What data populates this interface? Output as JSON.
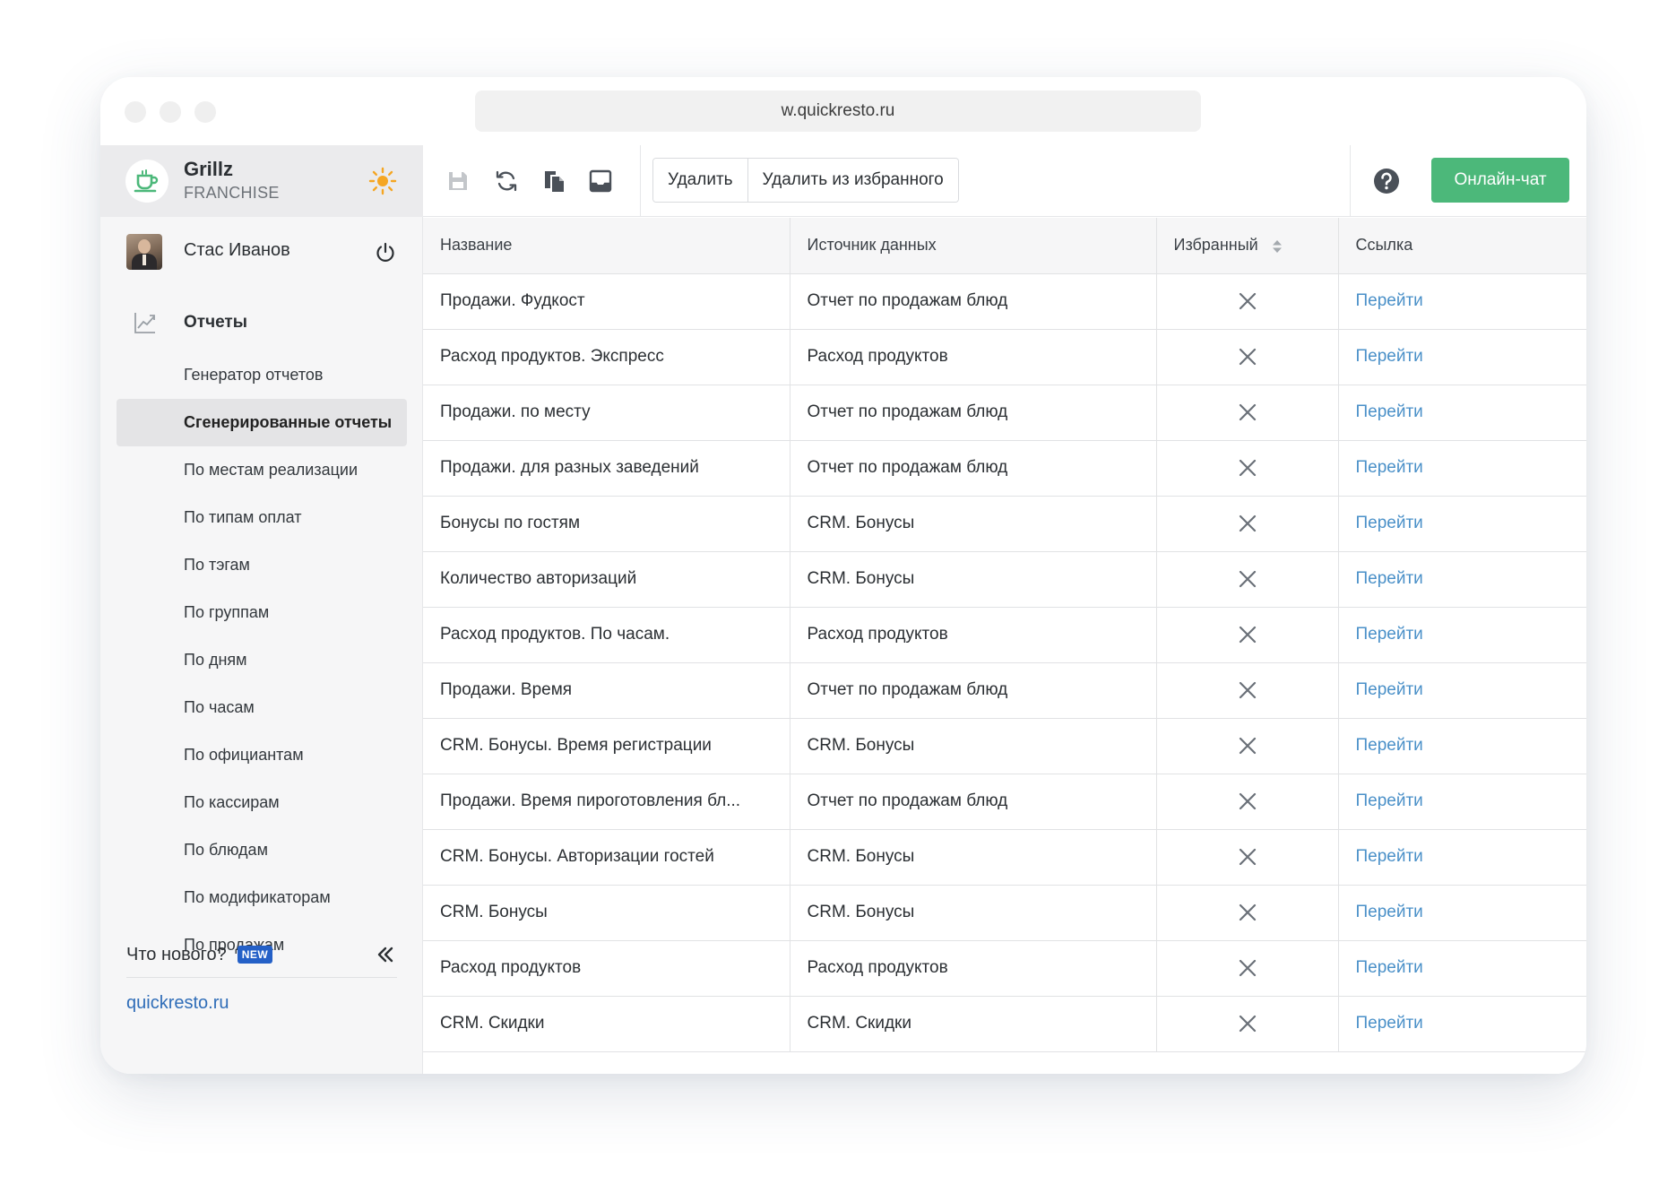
{
  "browser": {
    "url": "w.quickresto.ru"
  },
  "brand": {
    "name": "Grillz",
    "subtitle": "FRANCHISE",
    "logo_icon": "coffee-cup-icon",
    "accent": "#4cb87a"
  },
  "user": {
    "name": "Стас Иванов"
  },
  "nav": {
    "section_label": "Отчеты",
    "items": [
      {
        "label": "Генератор отчетов"
      },
      {
        "label": "Сгенерированные отчеты",
        "active": true
      },
      {
        "label": "По местам реализации"
      },
      {
        "label": "По типам оплат"
      },
      {
        "label": "По тэгам"
      },
      {
        "label": "По группам"
      },
      {
        "label": "По дням"
      },
      {
        "label": "По часам"
      },
      {
        "label": "По официантам"
      },
      {
        "label": "По кассирам"
      },
      {
        "label": "По блюдам"
      },
      {
        "label": "По модификаторам"
      },
      {
        "label": "По продажам"
      }
    ]
  },
  "footer": {
    "whats_new": "Что нового?",
    "new_badge": "NEW",
    "site_link": "quickresto.ru"
  },
  "toolbar": {
    "delete_label": "Удалить",
    "remove_favorite_label": "Удалить из избранного",
    "chat_label": "Онлайн-чат",
    "chat_color": "#4cb87a"
  },
  "table": {
    "columns": [
      "Название",
      "Источник данных",
      "Избранный",
      "Ссылка"
    ],
    "rows": [
      {
        "name": "Продажи. Фудкост",
        "source": "Отчет по продажам блюд",
        "link": "Перейти"
      },
      {
        "name": "Расход продуктов. Экспресс",
        "source": "Расход продуктов",
        "link": "Перейти"
      },
      {
        "name": "Продажи. по месту",
        "source": "Отчет по продажам блюд",
        "link": "Перейти"
      },
      {
        "name": "Продажи. для разных заведений",
        "source": "Отчет по продажам блюд",
        "link": "Перейти"
      },
      {
        "name": "Бонусы по гостям",
        "source": "CRM. Бонусы",
        "link": "Перейти"
      },
      {
        "name": "Количество авторизаций",
        "source": "CRM. Бонусы",
        "link": "Перейти"
      },
      {
        "name": "Расход продуктов. По часам.",
        "source": "Расход продуктов",
        "link": "Перейти"
      },
      {
        "name": "Продажи. Время",
        "source": "Отчет по продажам блюд",
        "link": "Перейти"
      },
      {
        "name": "CRM. Бонусы. Время регистрации",
        "source": "CRM. Бонусы",
        "link": "Перейти"
      },
      {
        "name": "Продажи. Время пироготовления бл...",
        "source": "Отчет по продажам блюд",
        "link": "Перейти"
      },
      {
        "name": "CRM. Бонусы. Авторизации гостей",
        "source": "CRM. Бонусы",
        "link": "Перейти"
      },
      {
        "name": "CRM. Бонусы",
        "source": "CRM. Бонусы",
        "link": "Перейти"
      },
      {
        "name": "Расход продуктов",
        "source": "Расход продуктов",
        "link": "Перейти"
      },
      {
        "name": "CRM. Скидки",
        "source": "CRM. Скидки",
        "link": "Перейти"
      }
    ]
  }
}
